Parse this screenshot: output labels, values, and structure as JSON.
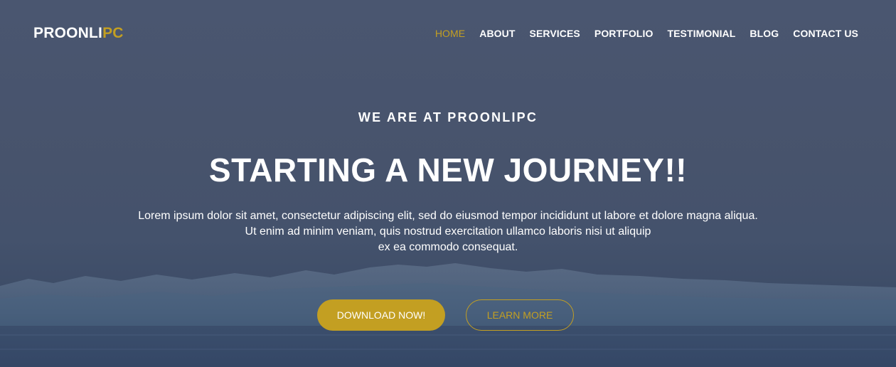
{
  "brand": {
    "name_main": "PROONLI",
    "name_accent": "PC",
    "accent_color": "#c39f22"
  },
  "nav": {
    "items": [
      {
        "label": "HOME",
        "active": true
      },
      {
        "label": "ABOUT",
        "active": false
      },
      {
        "label": "SERVICES",
        "active": false
      },
      {
        "label": "PORTFOLIO",
        "active": false
      },
      {
        "label": "TESTIMONIAL",
        "active": false
      },
      {
        "label": "BLOG",
        "active": false
      },
      {
        "label": "CONTACT US",
        "active": false
      }
    ]
  },
  "hero": {
    "kicker": "WE ARE AT PROONLIPC",
    "headline": "STARTING A NEW JOURNEY!!",
    "description_lines": [
      "Lorem ipsum dolor sit amet, consectetur adipiscing elit, sed do eiusmod tempor incididunt ut labore et dolore magna aliqua.",
      "Ut enim ad minim veniam, quis nostrud exercitation ullamco laboris nisi ut aliquip",
      "ex ea commodo consequat."
    ],
    "primary_button": "DOWNLOAD NOW!",
    "secondary_button": "LEARN MORE"
  }
}
